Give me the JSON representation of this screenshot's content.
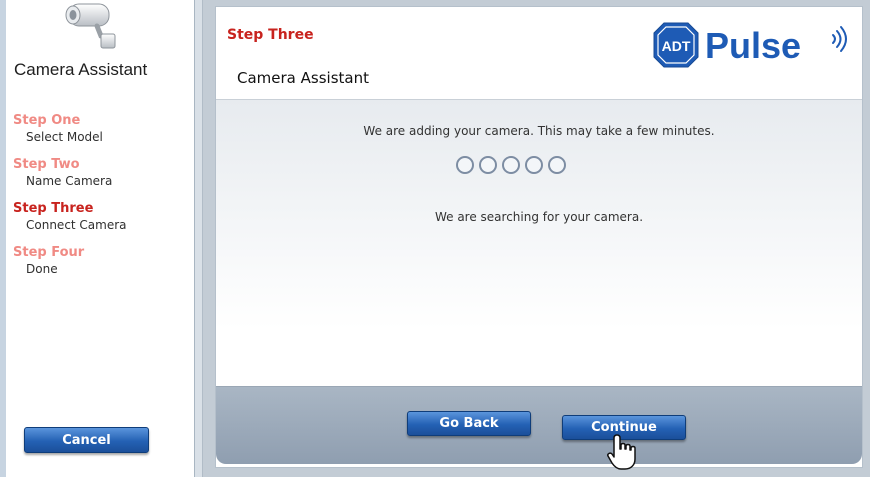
{
  "sidebar": {
    "title": "Camera Assistant",
    "steps": [
      {
        "title": "Step One",
        "subtitle": "Select Model"
      },
      {
        "title": "Step Two",
        "subtitle": "Name Camera"
      },
      {
        "title": "Step Three",
        "subtitle": "Connect Camera"
      },
      {
        "title": "Step Four",
        "subtitle": "Done"
      }
    ],
    "cancel_label": "Cancel"
  },
  "main": {
    "step_label": "Step Three",
    "title": "Camera Assistant",
    "brand_badge": "ADT",
    "brand_name": "Pulse",
    "status_message": "We are adding your camera. This may take a few minutes.",
    "search_message": "We are searching for your camera.",
    "go_back_label": "Go Back",
    "continue_label": "Continue"
  },
  "colors": {
    "active_step": "#c8231e",
    "inactive_step": "#f08a84",
    "brand_blue": "#1e5bb5",
    "button_blue": "#2461b4"
  },
  "icons": {
    "sidebar_logo": "security-camera-icon",
    "cursor": "hand-pointer-icon"
  }
}
